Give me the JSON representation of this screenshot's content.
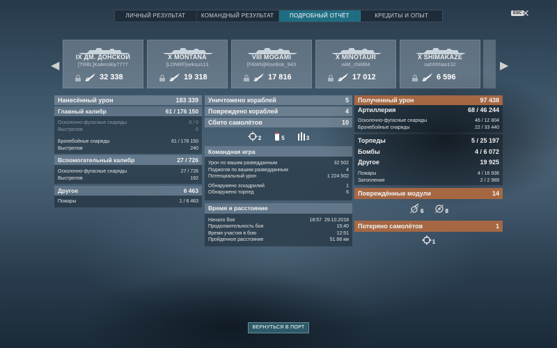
{
  "tabs": [
    {
      "label": "ЛИЧНЫЙ РЕЗУЛЬТАТ"
    },
    {
      "label": "КОМАНДНЫЙ РЕЗУЛЬТАТ"
    },
    {
      "label": "ПОДРОБНЫЙ ОТЧЁТ"
    },
    {
      "label": "КРЕДИТЫ И ОПЫТ"
    }
  ],
  "active_tab_index": 2,
  "esc_label": "ESC",
  "close_glyph": "✕",
  "nav": {
    "left": "◀",
    "right": "▶"
  },
  "ships": [
    {
      "name": "IX ДМ. ДОНСКОЙ",
      "player": "[TRBL]Kalenskiy7777",
      "damage": "32 338"
    },
    {
      "name": "X MONTANA",
      "player": "[LDNRF]xeksus13",
      "damage": "19 318"
    },
    {
      "name": "VIII MOGAMI",
      "player": "[FAWN]RiseBok_943",
      "damage": "17 816"
    },
    {
      "name": "X MINOTAUR",
      "player": "wild_child84",
      "damage": "17 012"
    },
    {
      "name": "X SHIMAKAZE",
      "player": "sahhhhaa132",
      "damage": "6 596"
    }
  ],
  "left": {
    "total": {
      "label": "Нанесённый урон",
      "value": "183 339"
    },
    "main": {
      "label": "Главный калибр",
      "value": "61 / 176 150",
      "he": {
        "label": "Осколочно-фугасные снаряды",
        "value": "0 / 0"
      },
      "he_shots": {
        "label": "Выстрелов",
        "value": "0"
      },
      "ap": {
        "label": "Бронебойные снаряды",
        "value": "61 / 176 150"
      },
      "ap_shots": {
        "label": "Выстрелов",
        "value": "240"
      }
    },
    "secondary": {
      "label": "Вспомогательный калибр",
      "value": "27 / 726",
      "he": {
        "label": "Осколочно-фугасные снаряды",
        "value": "27 / 726"
      },
      "shots": {
        "label": "Выстрелов",
        "value": "192"
      }
    },
    "other": {
      "label": "Другое",
      "value": "6 463",
      "fires": {
        "label": "Пожары",
        "value": "1 / 6 463"
      }
    }
  },
  "middle": {
    "destroyed": {
      "label": "Уничтожено кораблей",
      "value": "5"
    },
    "damaged": {
      "label": "Повреждено кораблей",
      "value": "4"
    },
    "planes": {
      "label": "Сбито самолётов",
      "value": "10"
    },
    "ribbons": [
      {
        "icon": "crosshair-icon",
        "count": "2"
      },
      {
        "icon": "fire-icon",
        "count": "5"
      },
      {
        "icon": "shells-icon",
        "count": "3"
      }
    ],
    "team": {
      "label": "Командная игра",
      "rows": [
        {
          "label": "Урон по вашим разведданным",
          "value": "32 502"
        },
        {
          "label": "Поджогов по вашим разведданным",
          "value": "4"
        },
        {
          "label": "Потенциальный урон",
          "value": "1 224 502"
        },
        {
          "label": "Обнаружено эскадрилий",
          "value": "1"
        },
        {
          "label": "Обнаружено торпед",
          "value": "6"
        }
      ]
    },
    "time": {
      "label": "Время и расстояние",
      "rows": [
        {
          "label": "Начало боя",
          "value": "18:57  29.10.2018"
        },
        {
          "label": "Продолжительность боя",
          "value": "15:40"
        },
        {
          "label": "Время участия в бою",
          "value": "12:51"
        },
        {
          "label": "Пройденное расстояние",
          "value": "51.68 км"
        }
      ]
    }
  },
  "right": {
    "received": {
      "label": "Полученный урон",
      "value": "97 438"
    },
    "artillery": {
      "label": "Артиллерия",
      "value": "68 / 46 244",
      "he": {
        "label": "Осколочно-фугасные снаряды",
        "value": "46 / 12 804"
      },
      "ap": {
        "label": "Бронебойные снаряды",
        "value": "22 / 33 440"
      }
    },
    "torpedoes": {
      "label": "Торпеды",
      "value": "5 / 25 197"
    },
    "bombs": {
      "label": "Бомбы",
      "value": "4 / 6 072"
    },
    "other": {
      "label": "Другое",
      "value": "19 925",
      "fires": {
        "label": "Пожары",
        "value": "4 / 16 936"
      },
      "floods": {
        "label": "Затопления",
        "value": "2 / 2 989"
      }
    },
    "modules": {
      "label": "Повреждённые модули",
      "value": "14",
      "icons": [
        {
          "icon": "broken-gun-icon",
          "count": "6"
        },
        {
          "icon": "broken-engine-icon",
          "count": "8"
        }
      ]
    },
    "planes_lost": {
      "label": "Потеряно самолётов",
      "value": "1",
      "icons": [
        {
          "icon": "plane-target-icon",
          "count": "1"
        }
      ]
    }
  },
  "return_button": "ВЕРНУТЬСЯ В ПОРТ"
}
